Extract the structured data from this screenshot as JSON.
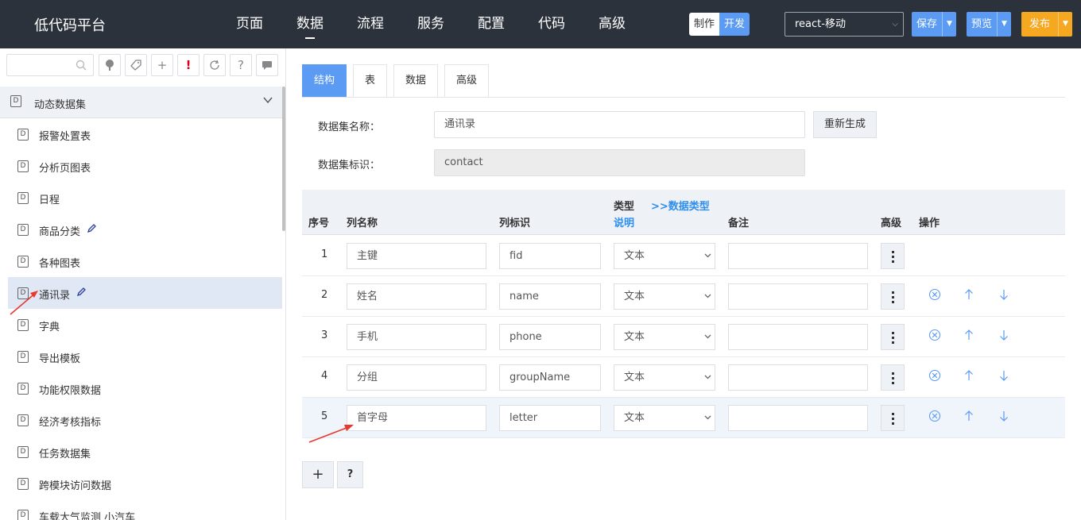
{
  "brand": "低代码平台",
  "nav": [
    "页面",
    "数据",
    "流程",
    "服务",
    "配置",
    "代码",
    "高级"
  ],
  "nav_active": "数据",
  "mode": {
    "make": "制作",
    "dev": "开发"
  },
  "framework": "react-移动",
  "actions": {
    "save": "保存",
    "preview": "预览",
    "publish": "发布"
  },
  "sidebar": {
    "group": "动态数据集",
    "items": [
      {
        "label": "报警处置表"
      },
      {
        "label": "分析页图表"
      },
      {
        "label": "日程"
      },
      {
        "label": "商品分类"
      },
      {
        "label": "各种图表"
      },
      {
        "label": "通讯录"
      },
      {
        "label": "字典"
      },
      {
        "label": "导出模板"
      },
      {
        "label": "功能权限数据"
      },
      {
        "label": "经济考核指标"
      },
      {
        "label": "任务数据集"
      },
      {
        "label": "跨模块访问数据"
      },
      {
        "label": "车载大气监测 小汽车"
      }
    ],
    "active_index": 5,
    "icon_letter": "D"
  },
  "tabs": [
    "结构",
    "表",
    "数据",
    "高级"
  ],
  "form": {
    "name_label": "数据集名称：",
    "name_value": "通讯录",
    "regen_label": "重新生成",
    "id_label": "数据集标识：",
    "id_value": "contact"
  },
  "table": {
    "headers": {
      "seq": "序号",
      "col_name": "列名称",
      "col_id": "列标识",
      "type": "类型",
      "type_link": ">>数据类型",
      "type_note": "说明",
      "remark": "备注",
      "advanced": "高级",
      "ops": "操作"
    },
    "rows": [
      {
        "seq": "1",
        "name": "主键",
        "id": "fid",
        "type": "文本",
        "remark": ""
      },
      {
        "seq": "2",
        "name": "姓名",
        "id": "name",
        "type": "文本",
        "remark": ""
      },
      {
        "seq": "3",
        "name": "手机",
        "id": "phone",
        "type": "文本",
        "remark": ""
      },
      {
        "seq": "4",
        "name": "分组",
        "id": "groupName",
        "type": "文本",
        "remark": ""
      },
      {
        "seq": "5",
        "name": "首字母",
        "id": "letter",
        "type": "文本",
        "remark": ""
      }
    ]
  },
  "bottom": {
    "add": "+",
    "help": "?"
  },
  "colors": {
    "topbar": "#2c323b",
    "accent": "#5b9bf3",
    "publish": "#f6a821",
    "link": "#2e8ff0",
    "annotation": "#e8382f"
  }
}
